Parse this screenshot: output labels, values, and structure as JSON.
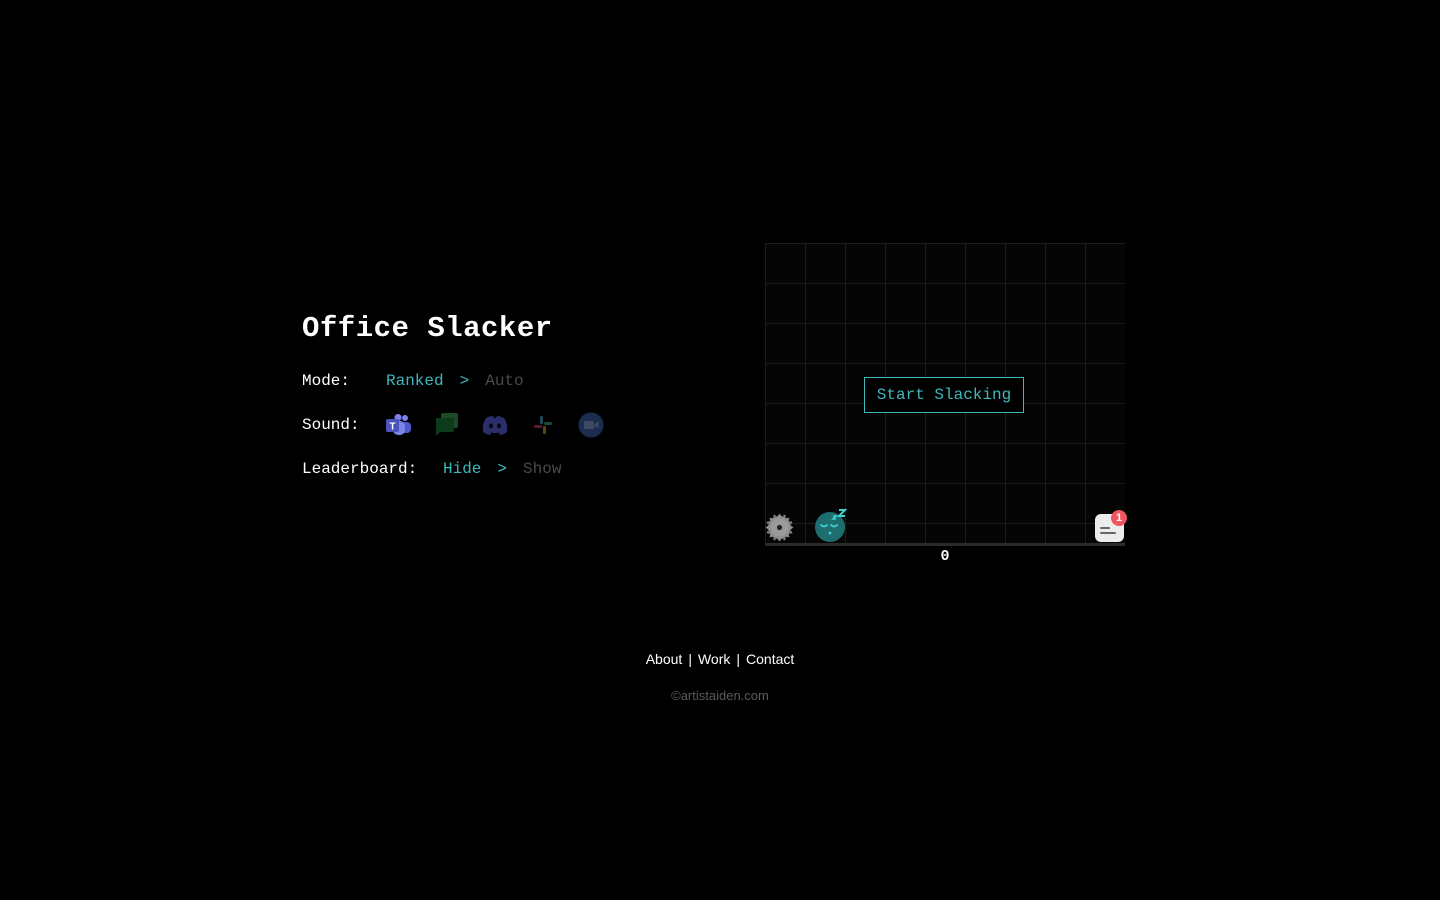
{
  "title": "Office Slacker",
  "options": {
    "mode": {
      "label": "Mode:",
      "selected": "Ranked",
      "separator": ">",
      "alternate": "Auto"
    },
    "sound": {
      "label": "Sound:",
      "icons": [
        {
          "name": "teams-icon",
          "title": "Microsoft Teams",
          "color": "#4b53bc",
          "active": true
        },
        {
          "name": "google-chat-icon",
          "title": "Google Chat",
          "color": "#0f3d20",
          "active": false
        },
        {
          "name": "discord-icon",
          "title": "Discord",
          "color": "#2a2f6b",
          "active": false
        },
        {
          "name": "slack-icon",
          "title": "Slack",
          "color": "#3a2a2a",
          "active": false
        },
        {
          "name": "zoom-icon",
          "title": "Zoom",
          "color": "#1b2c4f",
          "active": false
        }
      ]
    },
    "leaderboard": {
      "label": "Leaderboard:",
      "selected": "Hide",
      "separator": ">",
      "alternate": "Show"
    }
  },
  "game": {
    "start_label": "Start Slacking",
    "score": "0",
    "notification_count": "1",
    "colors": {
      "accent": "#3fb8bd",
      "player": "#1f6e6f",
      "badge": "#f0555f"
    }
  },
  "footer": {
    "links": [
      "About",
      "Work",
      "Contact"
    ],
    "separator": "|",
    "copyright": "©artistaiden.com"
  }
}
